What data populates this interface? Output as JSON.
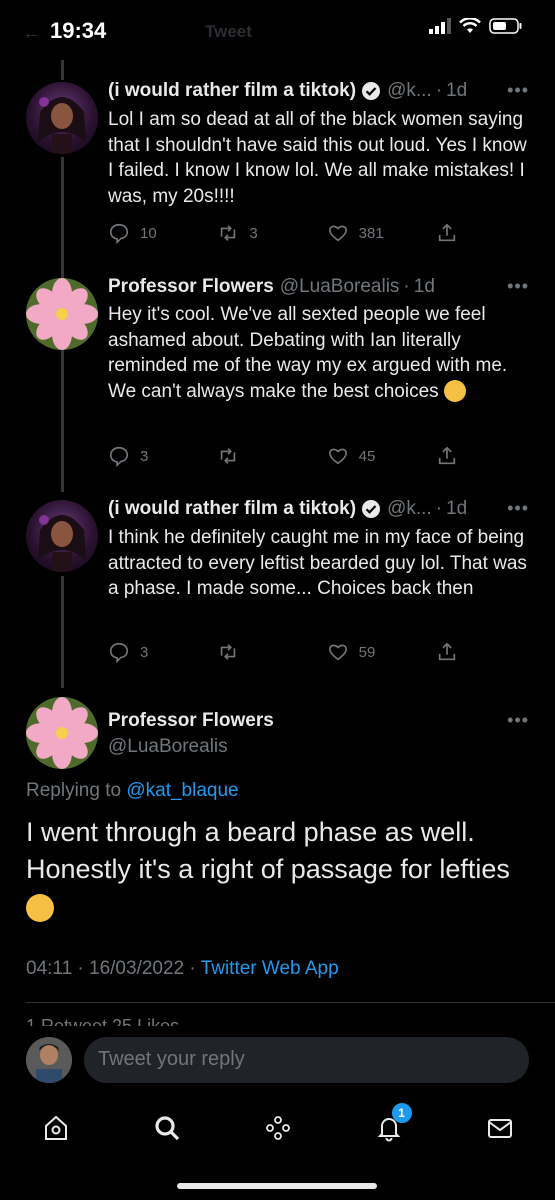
{
  "status": {
    "time": "19:34"
  },
  "header": {
    "title": "Tweet"
  },
  "tweets": [
    {
      "name": "(i would rather film a tiktok)",
      "handle": "@k...",
      "time": "1d",
      "text": "Lol I am so dead at all of the black women saying that I shouldn't have said this out loud. Yes I know I failed. I know I know lol. We all make mistakes! I was, my 20s!!!!",
      "replies": "10",
      "retweets": "3",
      "likes": "381"
    },
    {
      "name": "Professor Flowers",
      "handle": "@LuaBorealis",
      "time": "1d",
      "text": "Hey it's cool. We've all sexted people we feel ashamed about. Debating with Ian literally reminded me of the way my ex argued with me. We can't always make the best choices",
      "replies": "3",
      "retweets": "",
      "likes": "45"
    },
    {
      "name": "(i would rather film a tiktok)",
      "handle": "@k...",
      "time": "1d",
      "text": "I think he definitely caught me in my face of being attracted to every leftist bearded guy lol. That was a phase. I made some... Choices back then",
      "replies": "3",
      "retweets": "",
      "likes": "59"
    }
  ],
  "focus": {
    "name": "Professor Flowers",
    "handle": "@LuaBorealis",
    "replying_prefix": "Replying to",
    "replying_to": "@kat_blaque",
    "text": "I went through a beard phase as well. Honestly it's a right of passage for lefties",
    "timestamp": "04:11 · 16/03/2022",
    "separator": "·",
    "source": "Twitter Web App",
    "stats": "1 Retweet 25 Likes"
  },
  "reply": {
    "placeholder": "Tweet your reply"
  },
  "nav": {
    "notifications_badge": "1"
  },
  "colors": {
    "accent": "#1d9bf0",
    "background": "#000000",
    "muted": "#71767b"
  }
}
